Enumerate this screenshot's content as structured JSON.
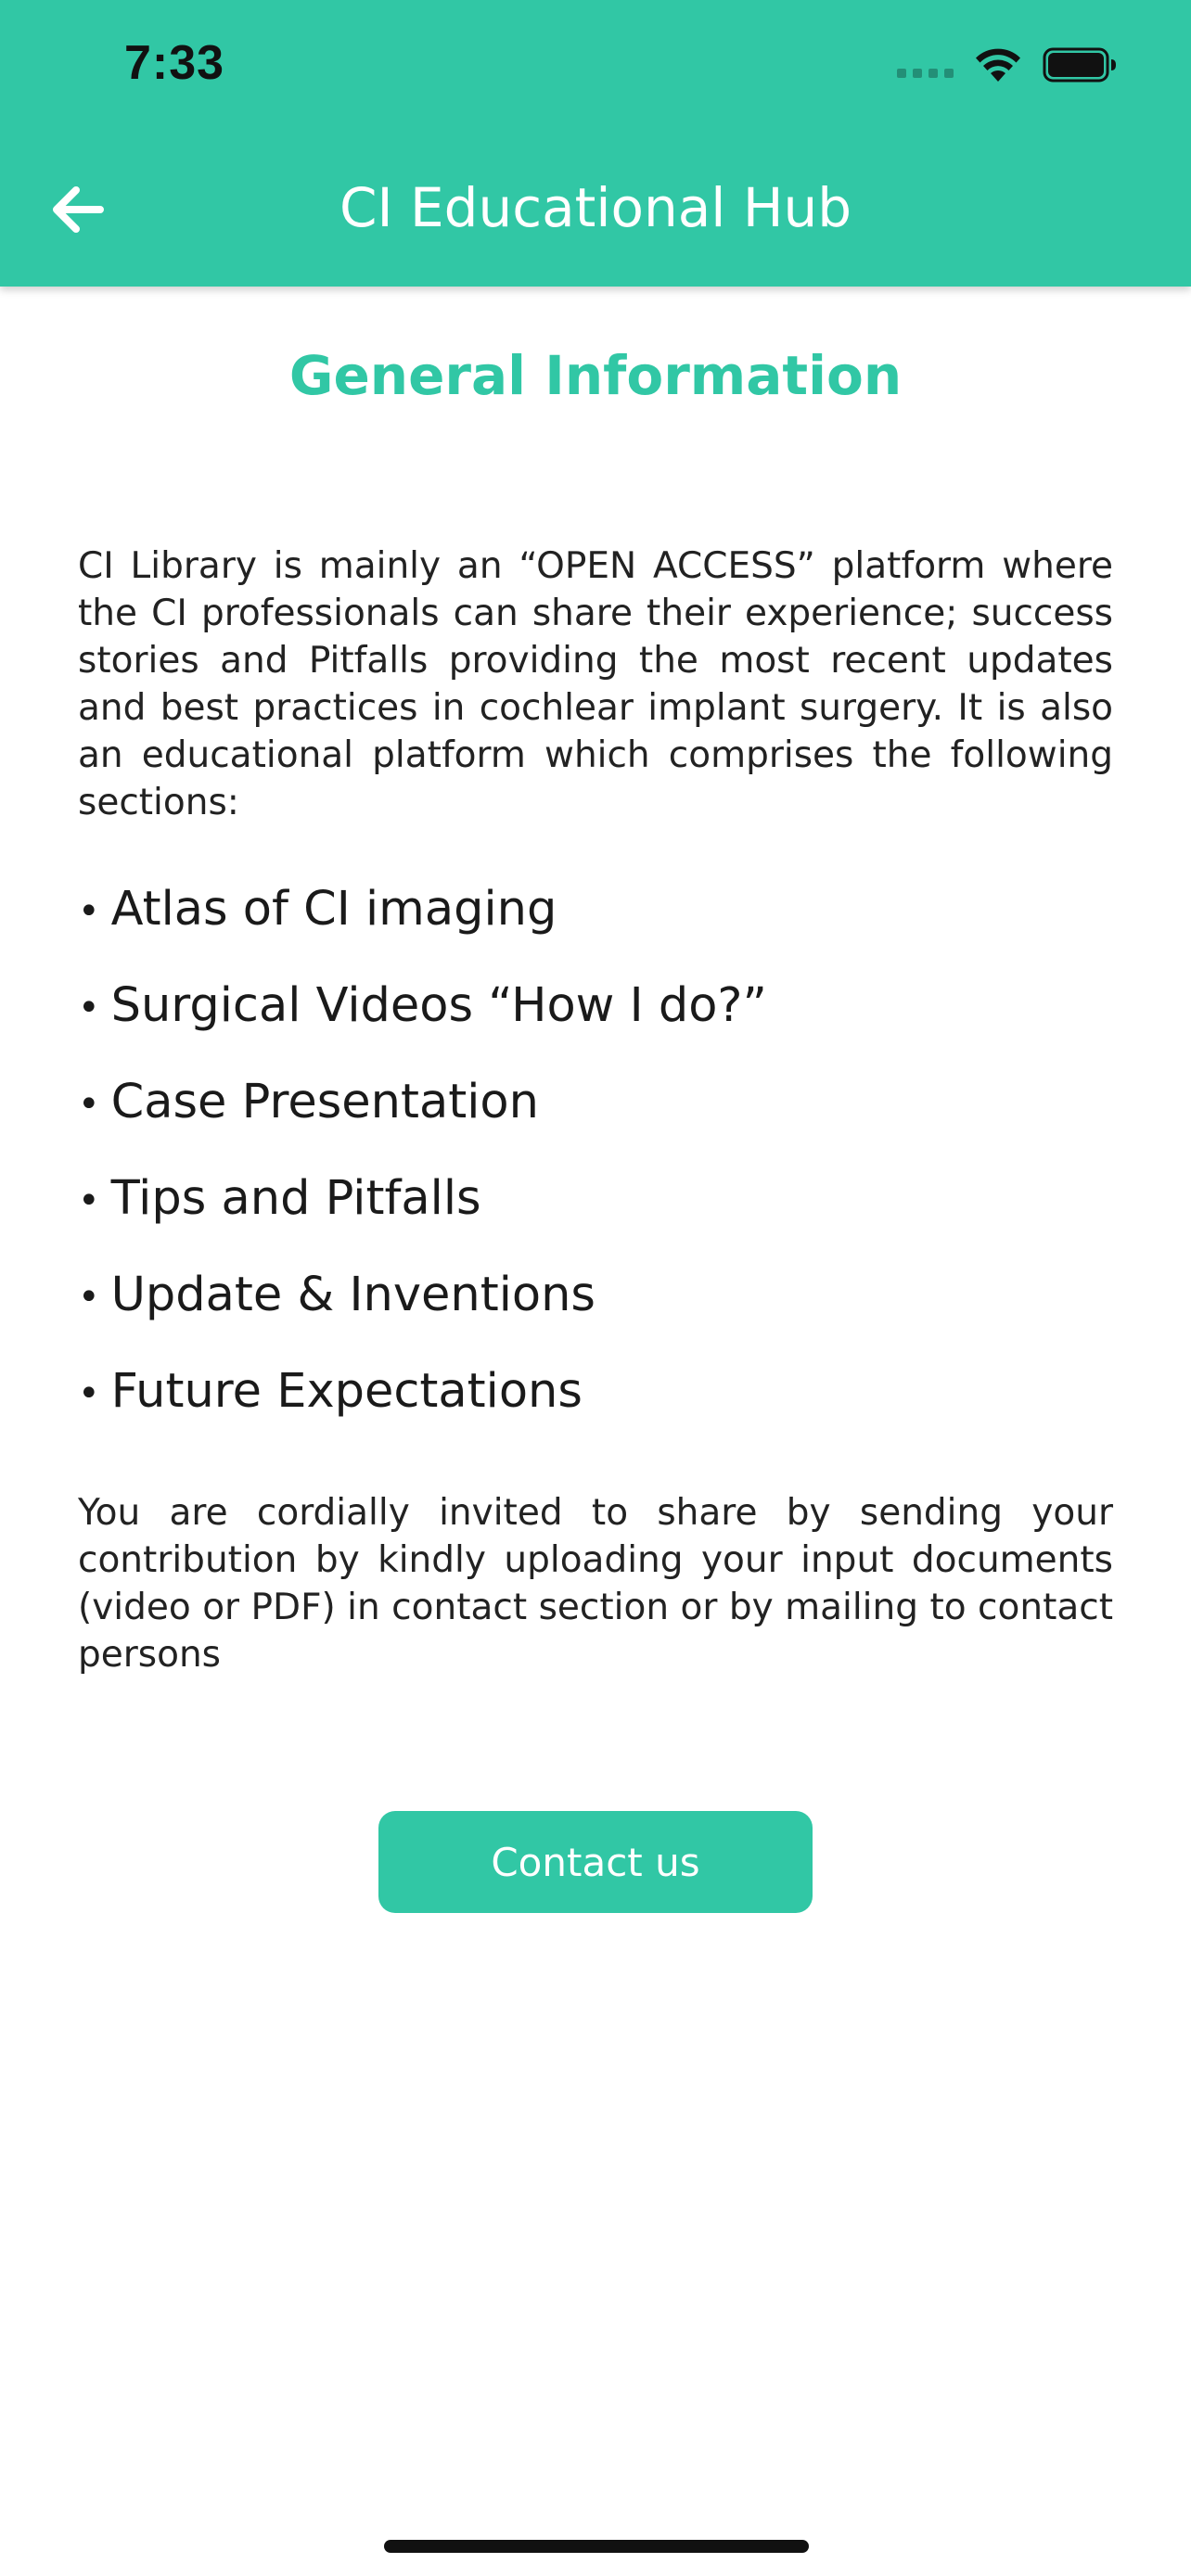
{
  "status_bar": {
    "time": "7:33"
  },
  "header": {
    "title": "CI Educational Hub"
  },
  "page": {
    "title": "General Information",
    "intro": "CI Library is mainly an “OPEN ACCESS” platform where the CI professionals can share their experience; success stories and Pitfalls providing the most recent updates and best practices in cochlear implant surgery. It is also an educational platform which comprises the following sections:",
    "sections": [
      "Atlas of CI imaging",
      "Surgical Videos “How I do?”",
      "Case Presentation",
      "Tips and Pitfalls",
      "Update & Inventions",
      "Future Expectations"
    ],
    "invite": "You are cordially invited to share by sending your contribution by kindly uploading your input documents (video or PDF) in contact section or by mailing to contact persons",
    "contact_button": "Contact us"
  },
  "icons": {
    "back": "arrow-left-icon",
    "wifi": "wifi-icon",
    "battery": "battery-icon",
    "signal": "cellular-signal-icon"
  },
  "colors": {
    "accent": "#31c7a5",
    "text": "#222222",
    "background": "#ffffff"
  }
}
